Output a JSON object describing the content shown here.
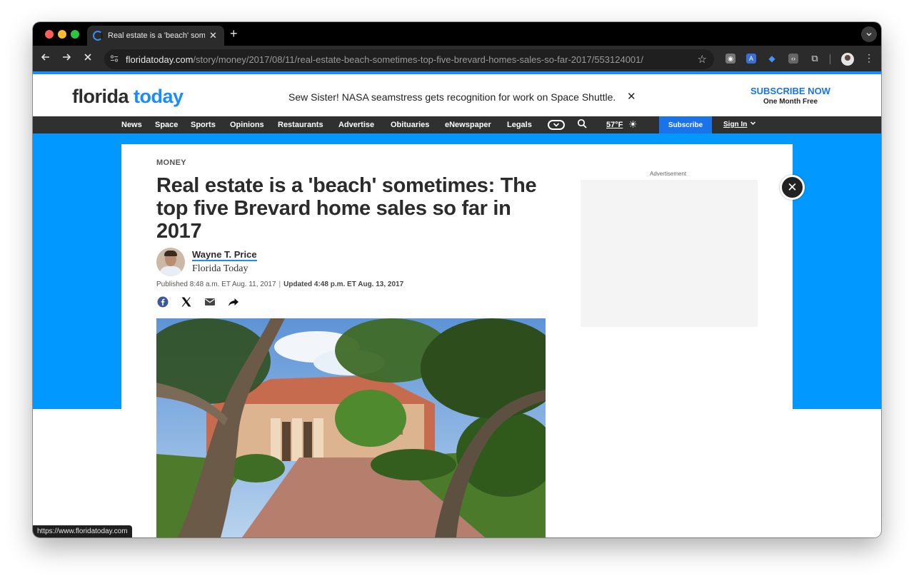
{
  "browser": {
    "tab_title": "Real estate is a 'beach' sometimes: The top five Brevard home sales so far in 2017",
    "tab_close": "✕",
    "new_tab": "+",
    "url_host": "floridatoday.com",
    "url_path": "/story/money/2017/08/11/real-estate-beach-sometimes-top-five-brevard-homes-sales-so-far-2017/553124001/",
    "status_url": "https://www.floridatoday.com",
    "accent": "#1a8cff"
  },
  "masthead": {
    "logo_part1": "florida",
    "logo_part2": "today",
    "promo_headline": "Sew Sister! NASA seamstress gets recognition for work on Space Shuttle.",
    "promo_close": "✕",
    "subscribe_now": "SUBSCRIBE NOW",
    "one_month": "One Month Free"
  },
  "nav": {
    "items": [
      "News",
      "Space",
      "Sports",
      "Opinions",
      "Restaurants",
      "Advertise",
      "Obituaries",
      "eNewspaper",
      "Legals"
    ],
    "weather": "57°F",
    "subscribe": "Subscribe",
    "sign_in": "Sign In"
  },
  "article": {
    "section": "MONEY",
    "title": "Real estate is a 'beach' sometimes: The top five Brevard home sales so far in 2017",
    "author": "Wayne T. Price",
    "organization": "Florida Today",
    "published": "Published 8:48 a.m. ET Aug. 11, 2017",
    "updated": "Updated 4:48 p.m. ET Aug. 13, 2017",
    "separator": "|"
  },
  "ad": {
    "label": "Advertisement",
    "close": "✕"
  }
}
